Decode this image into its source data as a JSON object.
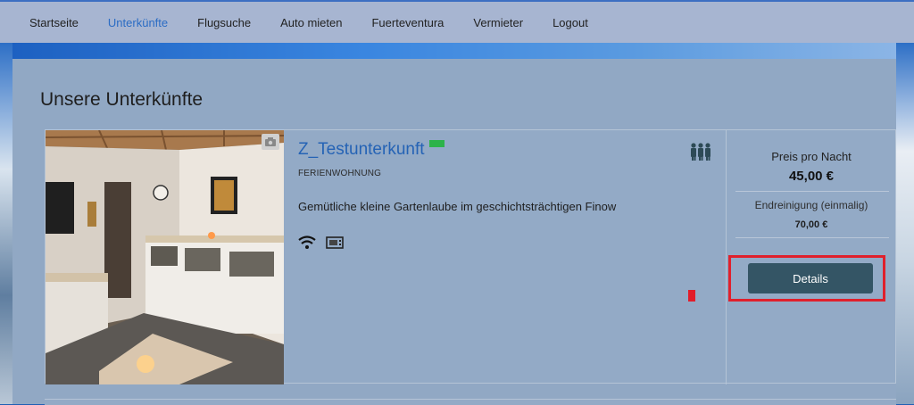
{
  "nav": {
    "items": [
      {
        "label": "Startseite",
        "active": false
      },
      {
        "label": "Unterkünfte",
        "active": true
      },
      {
        "label": "Flugsuche",
        "active": false
      },
      {
        "label": "Auto mieten",
        "active": false
      },
      {
        "label": "Fuerteventura",
        "active": false
      },
      {
        "label": "Vermieter",
        "active": false
      },
      {
        "label": "Logout",
        "active": false
      }
    ]
  },
  "page": {
    "title": "Unsere Unterkünfte"
  },
  "listing": {
    "title": "Z_Testunterkunft",
    "type": "FERIENWOHNUNG",
    "description": "Gemütliche kleine Gartenlaube im geschichtsträchtigen Finow",
    "amenity_icons": [
      "wifi-icon",
      "tv-icon"
    ],
    "capacity_icon": "people-icon",
    "photo_badge_icon": "camera-icon",
    "status_color": "#2db34a",
    "price": {
      "per_night_label": "Preis pro Nacht",
      "per_night_value": "45,00 €",
      "cleaning_label": "Endreinigung (einmalig)",
      "cleaning_value": "70,00 €"
    },
    "details_button": "Details"
  },
  "colors": {
    "accent": "#2563b5",
    "button": "#345565",
    "highlight": "#e0202c"
  }
}
